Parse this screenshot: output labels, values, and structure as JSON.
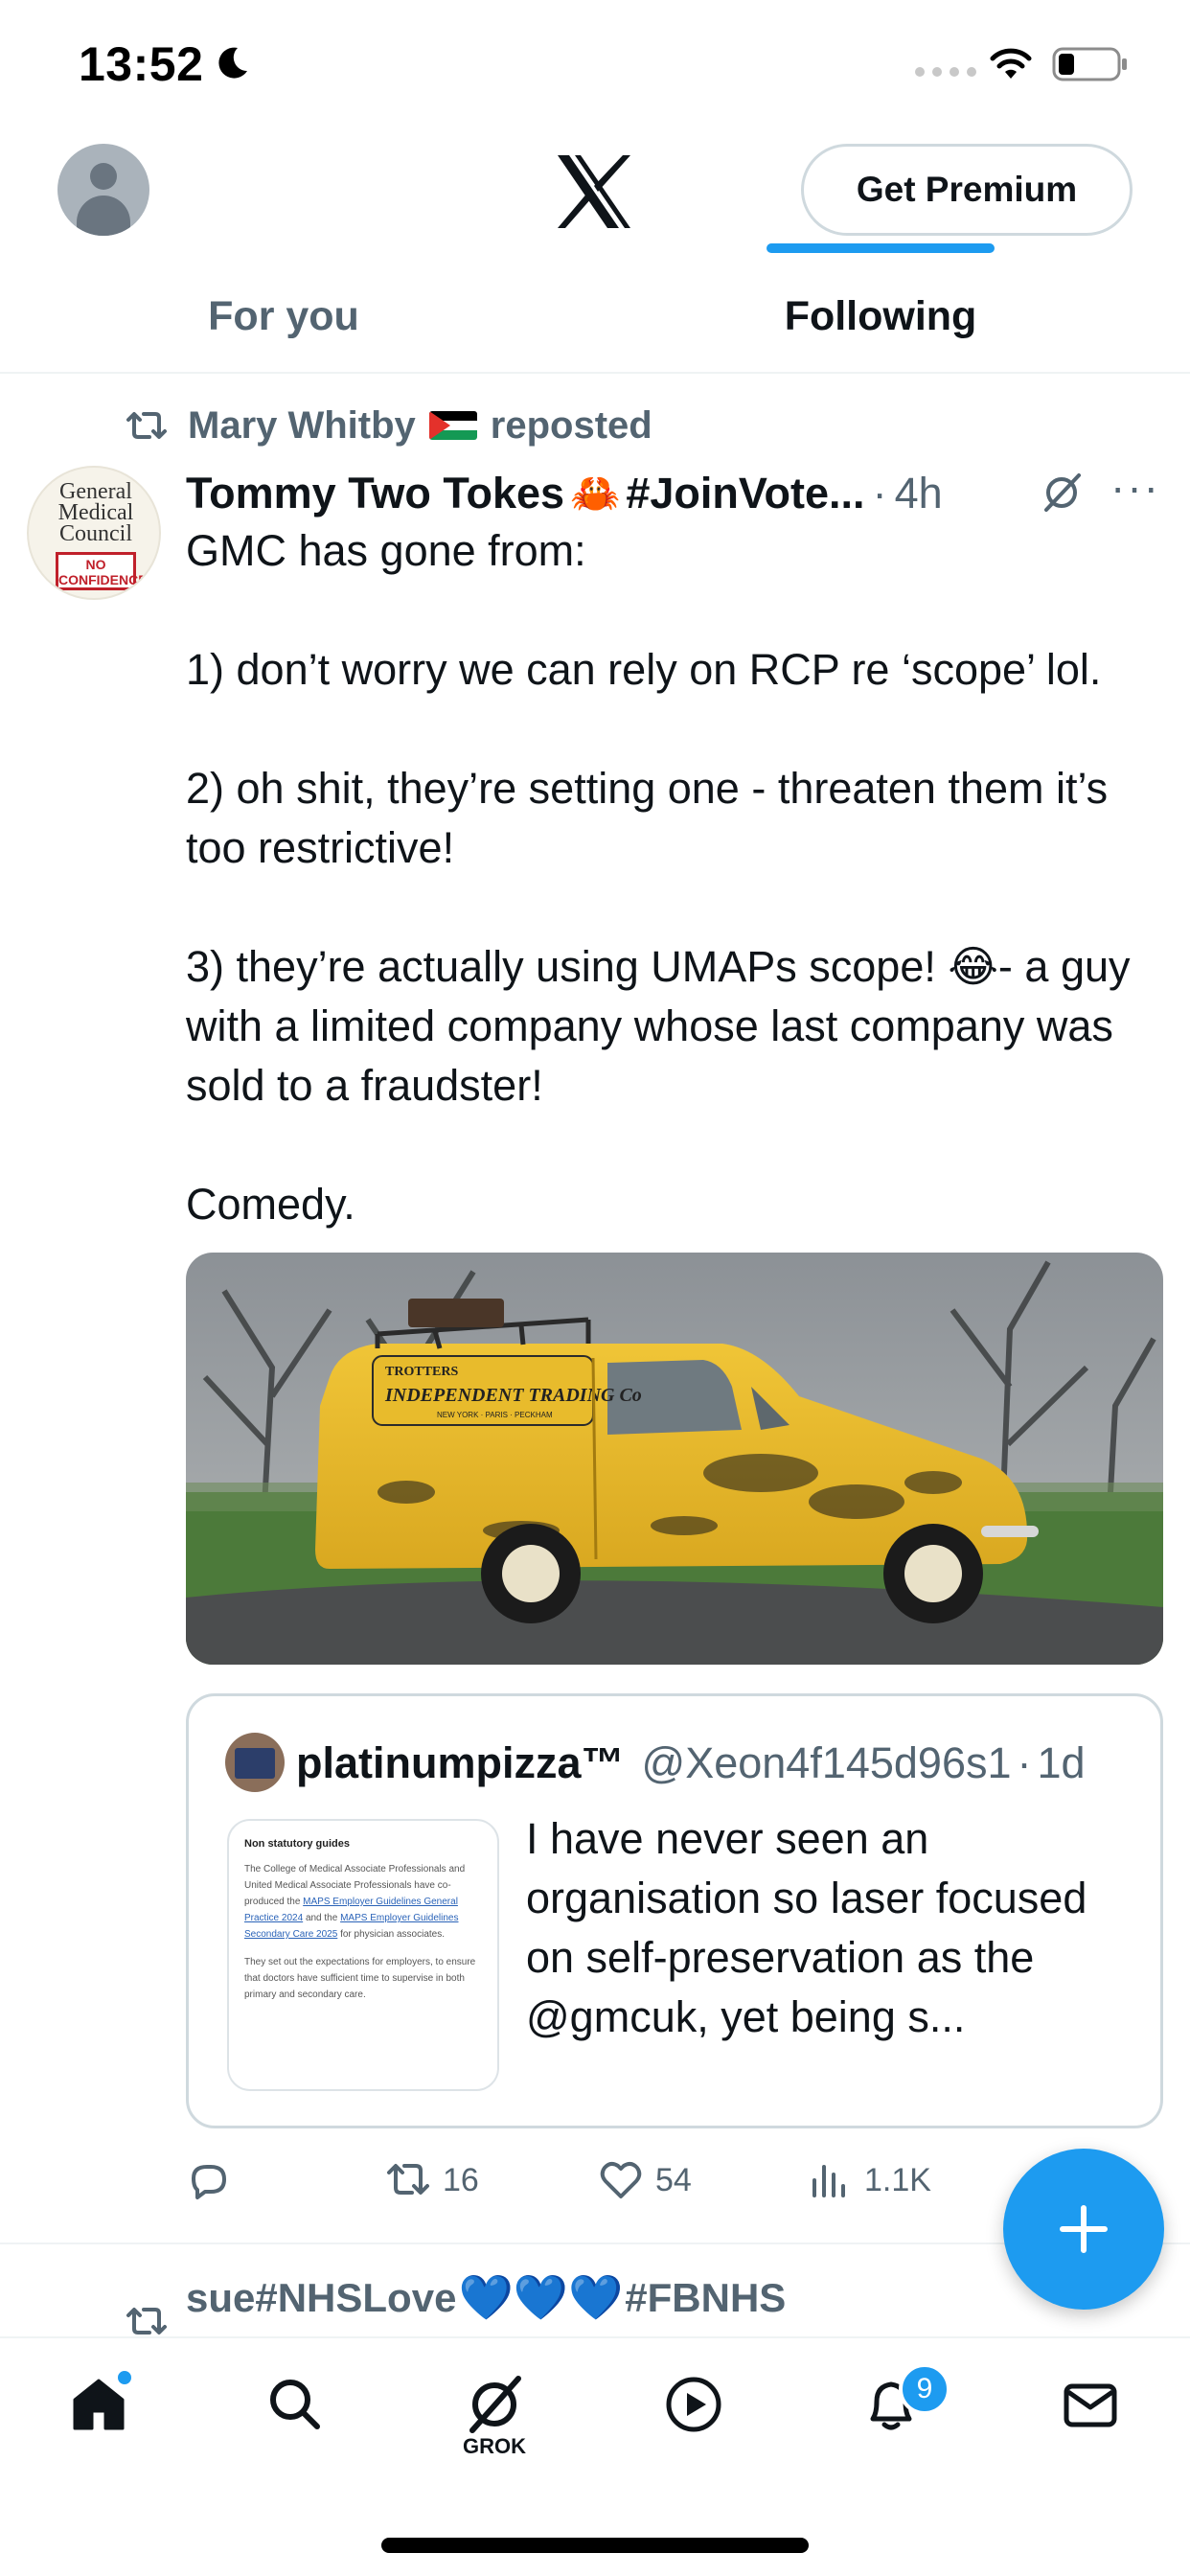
{
  "status_bar": {
    "time": "13:52"
  },
  "header": {
    "premium_label": "Get Premium",
    "tabs": [
      {
        "label": "For you",
        "active": false
      },
      {
        "label": "Following",
        "active": true
      }
    ]
  },
  "post": {
    "repost_by": "Mary Whitby",
    "repost_suffix": "reposted",
    "avatar_text": {
      "line1": "General",
      "line2": "Medical",
      "line3": "Council",
      "badge": "NO CONFIDENCE"
    },
    "author_name": "Tommy Two Tokes",
    "author_tag": "#JoinVote...",
    "time": "4h",
    "text": "GMC has gone from:\n\n1) don’t worry we can rely on RCP re ‘scope’ lol.\n\n2) oh shit, they’re setting one - threaten them it’s too restrictive!\n\n3) they’re actually using UMAPs scope! 😂- a guy with a limited company whose last company was sold to a fraudster!\n\nComedy.",
    "media": {
      "van_sign_line1": "TROTTERS",
      "van_sign_line2": "INDEPENDENT TRADING Co",
      "van_sign_line3": "NEW YORK · PARIS · PECKHAM"
    },
    "quote": {
      "name": "platinumpizza™",
      "handle": "@Xeon4f145d96s1",
      "time": "1d",
      "text": "I have never seen an organisation so laser focused on self-preservation as the @gmcuk, yet being s...",
      "thumb_title": "Non statutory guides",
      "thumb_body_1": "The College of Medical Associate Professionals and United Medical Associate Professionals have co-produced the",
      "thumb_link_1": "MAPS Employer Guidelines General Practice 2024",
      "thumb_body_2": "and the",
      "thumb_link_2": "MAPS Employer Guidelines Secondary Care 2025",
      "thumb_body_3": "for physician associates.",
      "thumb_body_4": "They set out the expectations for employers, to ensure that doctors have sufficient time to supervise in both primary and secondary care."
    },
    "actions": {
      "reposts": "16",
      "likes": "54",
      "views": "1.1K"
    }
  },
  "next_post": {
    "repost_by": "sue#NHSLove",
    "repost_suffix": "#FBNHS"
  },
  "bottom_nav": {
    "grok_label": "GROK",
    "notification_count": "9"
  },
  "colors": {
    "accent": "#1d9bf0",
    "text_primary": "#0f1419",
    "text_secondary": "#536471",
    "border": "#cfd9de"
  },
  "icons": [
    "moon-icon",
    "wifi-icon",
    "battery-icon",
    "x-logo-icon",
    "repost-icon",
    "grok-icon",
    "more-icon",
    "reply-icon",
    "like-icon",
    "views-icon",
    "compose-icon",
    "home-icon",
    "search-icon",
    "video-icon",
    "notifications-icon",
    "messages-icon"
  ]
}
